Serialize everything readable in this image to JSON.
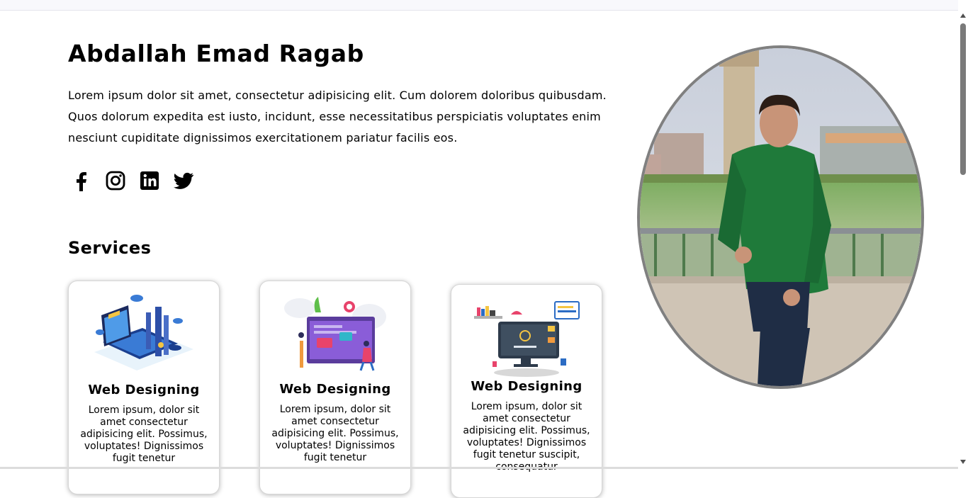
{
  "hero": {
    "name": "Abdallah Emad Ragab",
    "intro": "Lorem ipsum dolor sit amet, consectetur adipisicing elit. Cum dolorem doloribus quibusdam. Quos dolorum expedita est iusto, incidunt, esse necessitatibus perspiciatis voluptates enim nesciunt cupiditate dignissimos exercitationem pariatur facilis eos."
  },
  "social": [
    {
      "icon": "facebook-icon"
    },
    {
      "icon": "instagram-icon"
    },
    {
      "icon": "linkedin-icon"
    },
    {
      "icon": "twitter-icon"
    }
  ],
  "services": {
    "heading": "Services",
    "cards": [
      {
        "title": "Web Designing",
        "text": "Lorem ipsum, dolor sit amet consectetur adipisicing elit. Possimus, voluptates! Dignissimos fugit tenetur"
      },
      {
        "title": "Web Designing",
        "text": "Lorem ipsum, dolor sit amet consectetur adipisicing elit. Possimus, voluptates! Dignissimos fugit tenetur"
      },
      {
        "title": "Web Designing",
        "text": "Lorem ipsum, dolor sit amet consectetur adipisicing elit. Possimus, voluptates! Dignissimos fugit tenetur suscipit, consequatur"
      }
    ]
  },
  "portrait": {
    "image": "profile-photo",
    "border_color": "#808080"
  },
  "colors": {
    "text": "#000000",
    "background": "#ffffff",
    "accent_green": "#1f7a3a"
  }
}
